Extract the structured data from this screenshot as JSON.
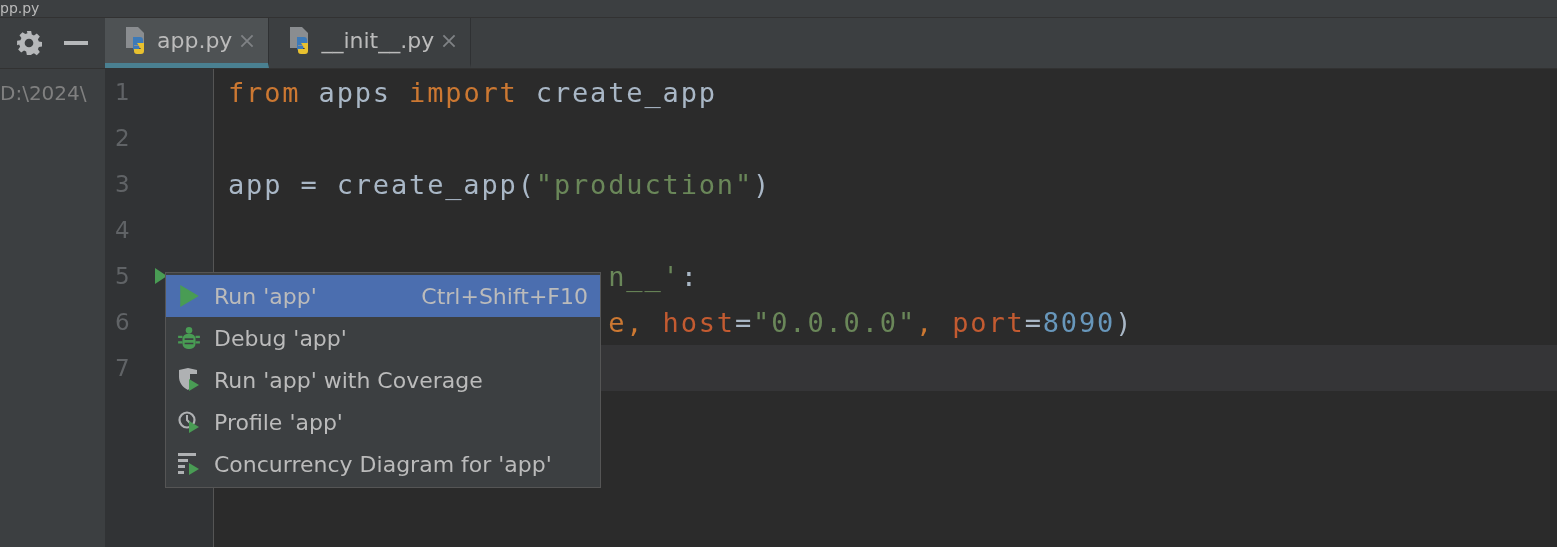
{
  "window": {
    "title": "pp.py"
  },
  "tool_panel": {
    "path": "D:\\2024\\"
  },
  "tabs": [
    {
      "label": "app.py",
      "selected": true
    },
    {
      "label": "__init__.py",
      "selected": false
    }
  ],
  "editor": {
    "lines": [
      {
        "number": "1",
        "current": false,
        "run_marker": false,
        "tokens": [
          {
            "text": "from",
            "kind": "keyword"
          },
          {
            "text": " apps ",
            "kind": "name"
          },
          {
            "text": "import",
            "kind": "keyword"
          },
          {
            "text": " create_app",
            "kind": "plain"
          }
        ]
      },
      {
        "number": "2",
        "current": false,
        "run_marker": false
      },
      {
        "number": "3",
        "current": false,
        "run_marker": false,
        "tokens": [
          {
            "text": "app = create_app(",
            "kind": "plain"
          },
          {
            "text": "\"production\"",
            "kind": "string"
          },
          {
            "text": ")",
            "kind": "plain"
          }
        ]
      },
      {
        "number": "4",
        "current": false,
        "run_marker": false
      },
      {
        "number": "5",
        "current": false,
        "run_marker": true,
        "tokens": [
          {
            "text": "n__'",
            "kind": "string"
          },
          {
            "text": ":",
            "kind": "plain"
          }
        ]
      },
      {
        "number": "6",
        "current": false,
        "run_marker": false,
        "tokens": [
          {
            "text": "e",
            "kind": "keyword"
          },
          {
            "text": ", ",
            "kind": "keyword"
          },
          {
            "text": "host",
            "kind": "param"
          },
          {
            "text": "=",
            "kind": "plain"
          },
          {
            "text": "\"0.0.0.0\"",
            "kind": "string"
          },
          {
            "text": ", ",
            "kind": "keyword"
          },
          {
            "text": "port",
            "kind": "param"
          },
          {
            "text": "=",
            "kind": "plain"
          },
          {
            "text": "8090",
            "kind": "number"
          },
          {
            "text": ")",
            "kind": "plain"
          }
        ]
      },
      {
        "number": "7",
        "current": true,
        "run_marker": false
      }
    ]
  },
  "context_menu": {
    "items": [
      {
        "kind": "run",
        "label": "Run 'app'",
        "shortcut": "Ctrl+Shift+F10",
        "selected": true
      },
      {
        "kind": "debug",
        "label": "Debug 'app'",
        "selected": false
      },
      {
        "kind": "coverage",
        "label": "Run 'app' with Coverage",
        "selected": false
      },
      {
        "kind": "profile",
        "label": "Profile 'app'",
        "selected": false
      },
      {
        "kind": "concurrency",
        "label": "Concurrency Diagram for 'app'",
        "selected": false
      }
    ]
  }
}
